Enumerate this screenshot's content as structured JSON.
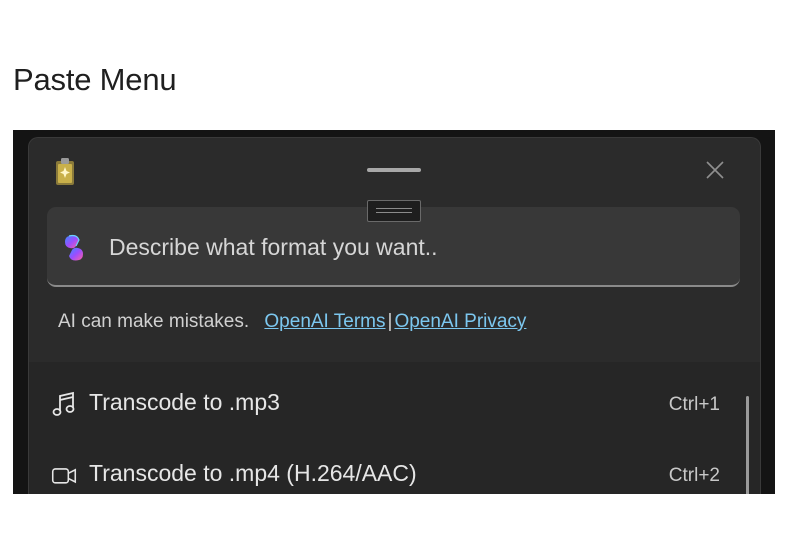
{
  "page": {
    "heading": "Paste Menu"
  },
  "panel": {
    "input": {
      "placeholder": "Describe what format you want.."
    },
    "disclaimer": {
      "text": "AI can make mistakes.",
      "terms_link": "OpenAI Terms",
      "separator": "|",
      "privacy_link": "OpenAI Privacy"
    },
    "items": [
      {
        "label": "Transcode to .mp3",
        "shortcut": "Ctrl+1",
        "icon": "music-note-icon"
      },
      {
        "label": "Transcode to .mp4 (H.264/AAC)",
        "shortcut": "Ctrl+2",
        "icon": "video-camera-icon"
      }
    ]
  },
  "colors": {
    "panel_bg": "#2b2b2b",
    "list_bg": "#262626",
    "input_bg": "#383838",
    "link": "#7cc7ef",
    "text": "#e6e6e6"
  }
}
